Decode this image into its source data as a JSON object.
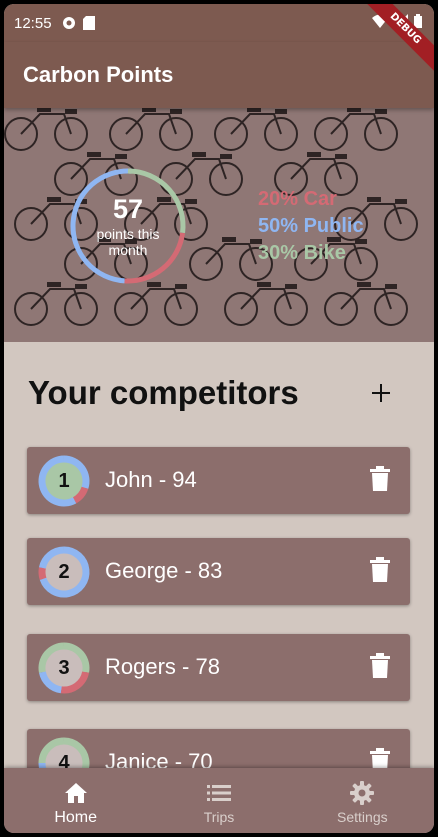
{
  "status_bar": {
    "time": "12:55"
  },
  "debug_banner": "DEBUG",
  "app_bar": {
    "title": "Carbon Points"
  },
  "summary": {
    "points": "57",
    "points_label": "points this month",
    "breakdown": [
      {
        "label": "20% Car",
        "fraction": 0.2,
        "color": "#d46a74"
      },
      {
        "label": "50% Public",
        "fraction": 0.5,
        "color": "#8fb6f2"
      },
      {
        "label": "30% Bike",
        "fraction": 0.3,
        "color": "#a9c7a6"
      }
    ]
  },
  "competitors_section": {
    "title": "Your competitors"
  },
  "competitors": [
    {
      "rank": "1",
      "label": "John - 94"
    },
    {
      "rank": "2",
      "label": "George - 83"
    },
    {
      "rank": "3",
      "label": "Rogers - 78"
    },
    {
      "rank": "4",
      "label": "Janice - 70"
    }
  ],
  "bottom_nav": [
    {
      "label": "Home",
      "icon": "home-icon",
      "active": true
    },
    {
      "label": "Trips",
      "icon": "list-icon",
      "active": false
    },
    {
      "label": "Settings",
      "icon": "gear-icon",
      "active": false
    }
  ],
  "colors": {
    "primary": "#7d5a50",
    "card": "#8c6e6c",
    "background": "#d2c7c0",
    "car": "#d46a74",
    "public": "#8fb6f2",
    "bike": "#a9c7a6"
  }
}
